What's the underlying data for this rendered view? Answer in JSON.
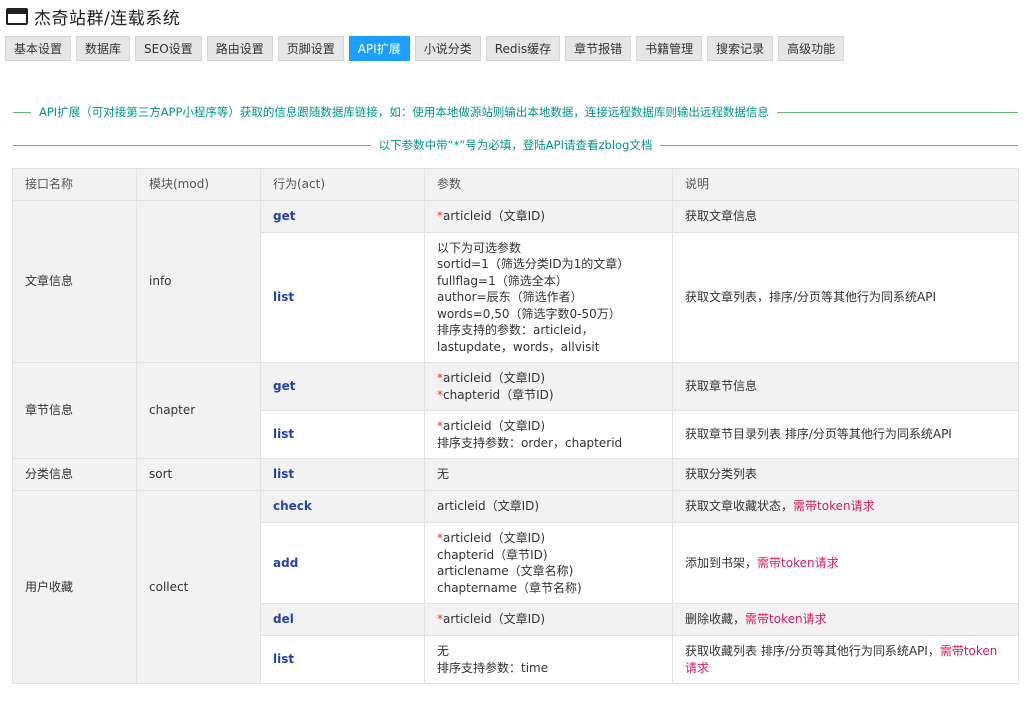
{
  "app": {
    "title": "杰奇站群/连载系统",
    "icon": "window-icon"
  },
  "tabs": [
    {
      "label": "基本设置",
      "active": false
    },
    {
      "label": "数据库",
      "active": false
    },
    {
      "label": "SEO设置",
      "active": false
    },
    {
      "label": "路由设置",
      "active": false
    },
    {
      "label": "页脚设置",
      "active": false
    },
    {
      "label": "API扩展",
      "active": true
    },
    {
      "label": "小说分类",
      "active": false
    },
    {
      "label": "Redis缓存",
      "active": false
    },
    {
      "label": "章节报错",
      "active": false
    },
    {
      "label": "书籍管理",
      "active": false
    },
    {
      "label": "搜索记录",
      "active": false
    },
    {
      "label": "高级功能",
      "active": false
    }
  ],
  "notes": {
    "intro": "API扩展（可对接第三方APP小程序等）获取的信息跟随数据库链接，如：使用本地做源站则输出本地数据，连接远程数据库则输出远程数据信息",
    "required_hint": "以下参数中带“*”号为必填，登陆API请查看zblog文档"
  },
  "table": {
    "headers": [
      "接口名称",
      "模块(mod)",
      "行为(act)",
      "参数",
      "说明"
    ],
    "groups": [
      {
        "name": "文章信息",
        "mod": "info",
        "rows": [
          {
            "act": "get",
            "params": [
              {
                "req": true,
                "text": "articleid（文章ID)"
              }
            ],
            "desc": "获取文章信息",
            "token": ""
          },
          {
            "act": "list",
            "params": [
              {
                "req": false,
                "text": "以下为可选参数"
              },
              {
                "req": false,
                "text": "sortid=1（筛选分类ID为1的文章）"
              },
              {
                "req": false,
                "text": "fullflag=1（筛选全本）"
              },
              {
                "req": false,
                "text": "author=辰东（筛选作者）"
              },
              {
                "req": false,
                "text": "words=0,50（筛选字数0-50万）"
              },
              {
                "req": false,
                "text": "排序支持的参数：articleid，lastupdate，words，allvisit"
              }
            ],
            "desc": "获取文章列表，排序/分页等其他行为同系统API",
            "token": ""
          }
        ]
      },
      {
        "name": "章节信息",
        "mod": "chapter",
        "rows": [
          {
            "act": "get",
            "params": [
              {
                "req": true,
                "text": "articleid（文章ID)"
              },
              {
                "req": true,
                "text": "chapterid（章节ID)"
              }
            ],
            "desc": "获取章节信息",
            "token": ""
          },
          {
            "act": "list",
            "params": [
              {
                "req": true,
                "text": "articleid（文章ID)"
              },
              {
                "req": false,
                "text": "排序支持参数：order，chapterid"
              }
            ],
            "desc": "获取章节目录列表 排序/分页等其他行为同系统API",
            "token": ""
          }
        ]
      },
      {
        "name": "分类信息",
        "mod": "sort",
        "rows": [
          {
            "act": "list",
            "params": [
              {
                "req": false,
                "text": "无"
              }
            ],
            "desc": "获取分类列表",
            "token": ""
          }
        ]
      },
      {
        "name": "用户收藏",
        "mod": "collect",
        "rows": [
          {
            "act": "check",
            "params": [
              {
                "req": false,
                "text": "articleid（文章ID)"
              }
            ],
            "desc": "获取文章收藏状态，",
            "token": "需带token请求"
          },
          {
            "act": "add",
            "params": [
              {
                "req": true,
                "text": "articleid（文章ID)"
              },
              {
                "req": false,
                "text": "chapterid（章节ID)"
              },
              {
                "req": false,
                "text": "articlename（文章名称)"
              },
              {
                "req": false,
                "text": "chaptername（章节名称)"
              }
            ],
            "desc": "添加到书架，",
            "token": "需带token请求"
          },
          {
            "act": "del",
            "params": [
              {
                "req": true,
                "text": "articleid（文章ID)"
              }
            ],
            "desc": "删除收藏，",
            "token": "需带token请求"
          },
          {
            "act": "list",
            "params": [
              {
                "req": false,
                "text": "无"
              },
              {
                "req": false,
                "text": "排序支持参数：time"
              }
            ],
            "desc": "获取收藏列表 排序/分页等其他行为同系统API，",
            "token": "需带token请求"
          }
        ]
      }
    ]
  }
}
